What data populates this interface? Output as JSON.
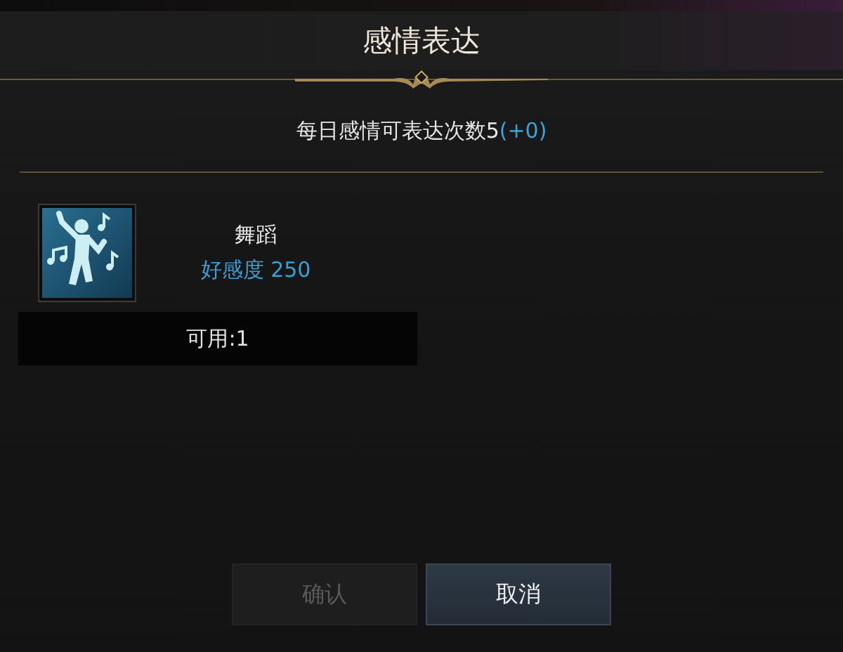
{
  "dialog": {
    "title": "感情表达"
  },
  "daily_limit": {
    "text": "每日感情可表达次数5",
    "bonus": "(+0)"
  },
  "emotes": [
    {
      "name": "舞蹈",
      "affinity": "好感度 250",
      "available": "可用:1",
      "selected": false
    }
  ],
  "buttons": [
    {
      "label": "确认",
      "disabled": true
    },
    {
      "label": "取消",
      "disabled": false
    }
  ]
}
